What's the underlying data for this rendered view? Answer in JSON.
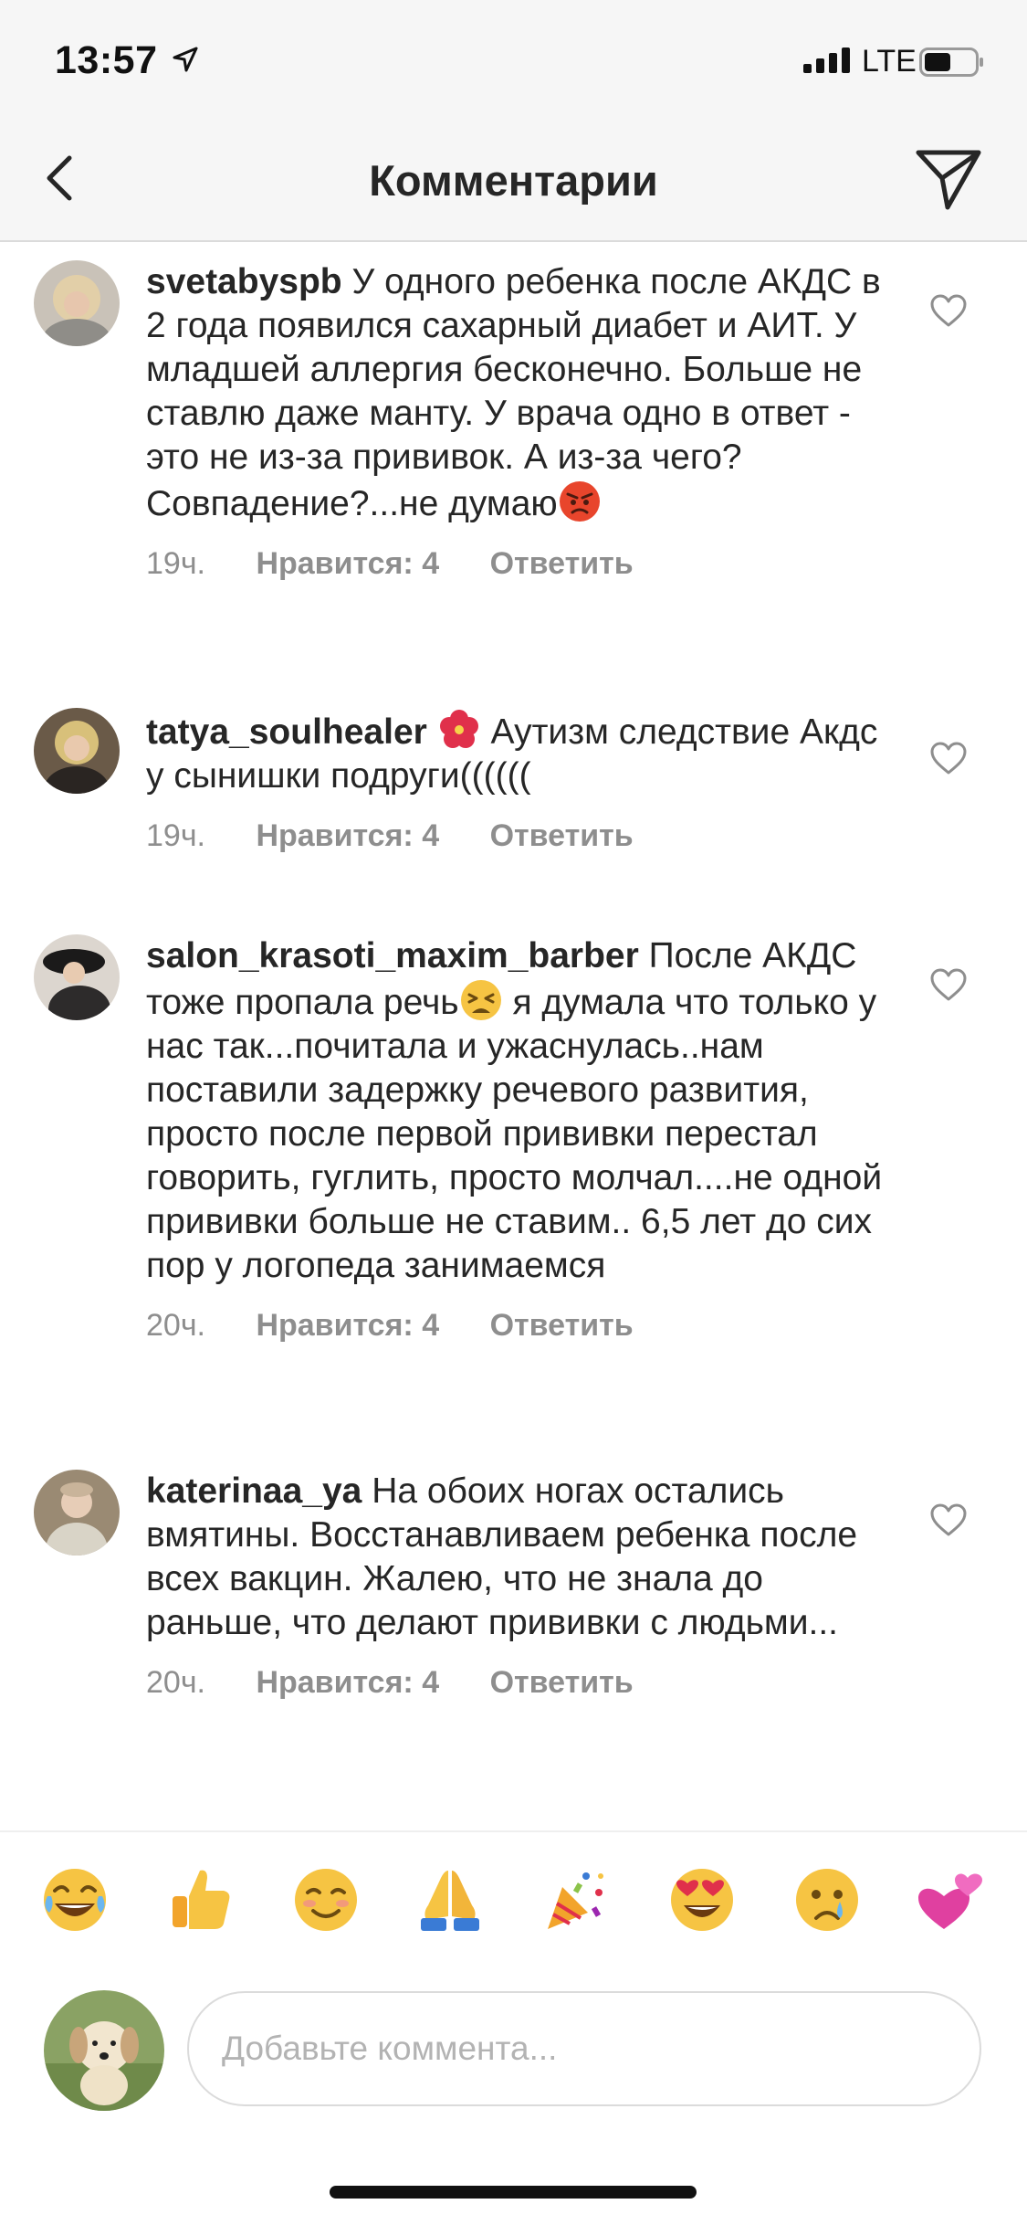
{
  "status_bar": {
    "time": "13:57",
    "network": "LTE"
  },
  "header": {
    "title": "Комментарии"
  },
  "comments": [
    {
      "username": "svetabyspb",
      "text": "У одного ребенка после АКДС в 2 года появился сахарный диабет и АИТ. У младшей аллергия бесконечно. Больше не ставлю даже манту. У врача одно в ответ - это не из-за прививок. А из-за чего? Совпадение?...не думаю",
      "emoji": "angry-face",
      "time": "19ч.",
      "likes": "Нравится: 4",
      "reply": "Ответить"
    },
    {
      "username": "tatya_soulhealer",
      "text": "Аутизм следствие Акдс у сынишки подруги((((((",
      "emoji": "hibiscus",
      "time": "19ч.",
      "likes": "Нравится: 4",
      "reply": "Ответить"
    },
    {
      "username": "salon_krasoti_maxim_barber",
      "text_before": "После АКДС тоже пропала речь",
      "text_after": " я думала что только у нас так...почитала и ужаснулась..нам поставили задержку речевого развития, просто после первой прививки перестал говорить, гуглить, просто молчал....не одной прививки больше не ставим.. 6,5 лет до сих пор у логопеда занимаемся",
      "emoji": "tired-face",
      "time": "20ч.",
      "likes": "Нравится: 4",
      "reply": "Ответить"
    },
    {
      "username": "katerinaa_ya",
      "text": "На обоих ногах остались вмятины. Восстанавливаем ребенка после всех вакцин. Жалею, что не знала до раньше, что делают прививки с людьми...",
      "time": "20ч.",
      "likes": "Нравится: 4",
      "reply": "Ответить"
    }
  ],
  "quick_emojis": [
    "joy",
    "thumbs-up",
    "smiling-face",
    "folded-hands",
    "party-popper",
    "heart-eyes",
    "crying-face",
    "two-hearts"
  ],
  "composer": {
    "placeholder": "Добавьте коммента..."
  }
}
